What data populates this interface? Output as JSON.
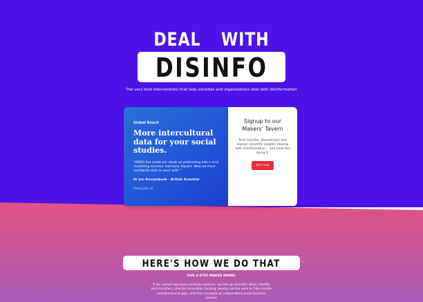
{
  "colors": {
    "hero_bg": "#4d12e8",
    "section_bg_top": "#ff5066",
    "section_bg_bottom": "#a95ab8",
    "card_left": "#2256d8",
    "button": "#ee2b3a"
  },
  "hero": {
    "title_line1_a": "DEAL",
    "title_line1_b": "WITH",
    "title_line2": "DISINFO",
    "tagline": "The very best interventions that help societies and organisations deal with disinformation"
  },
  "card": {
    "kicker": "Global Reach",
    "title": "More intercultural data for your social studies.",
    "quote": "\"DRDO has made our study on podcasting into a viral marketing success. Harmony Square. Now we have worldwide data to work with.\"",
    "author": "Dr Jon Roozenbeek - British Scientist",
    "link": "Come join us",
    "signup_title": "Signup to our Makers' Tavern",
    "signup_text": "Tech transfer, disseminate and explain scientific insights dealing with disinformation... and have fun doing it.",
    "join_button": "Join now"
  },
  "how": {
    "title": "HERE'S HOW WE DO THAT",
    "subtitle": "OUR 4-STEP MAKER MODEL",
    "text": "If we cannot repurpose existing solutions, we line up scientific ideas, identify tech transfers, allocate innovation funding, beamy out the work to fully remote entrepreneurial gigs, and then incubate an independent social business spinout."
  }
}
